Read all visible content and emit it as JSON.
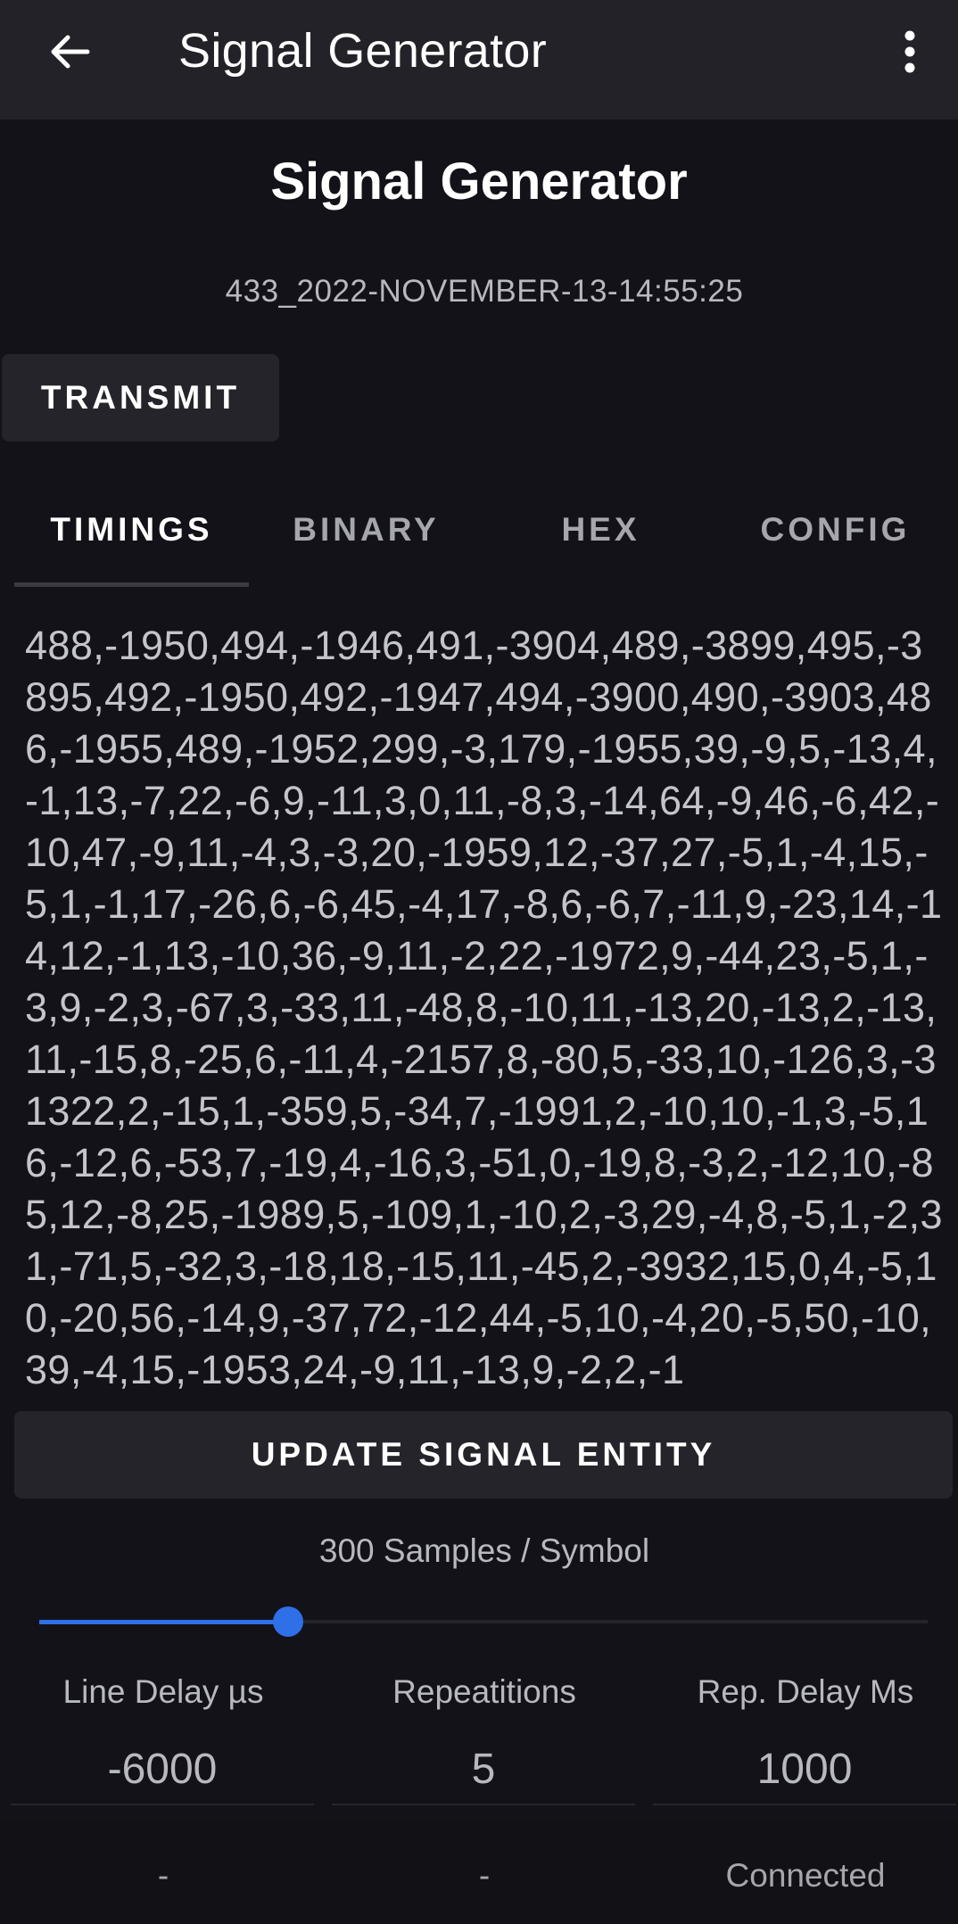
{
  "appbar": {
    "title": "Signal Generator",
    "back_icon": "arrow-left-icon",
    "more_icon": "more-vertical-icon"
  },
  "page": {
    "title": "Signal Generator",
    "signal_name": "433_2022-NOVEMBER-13-14:55:25"
  },
  "buttons": {
    "transmit": "TRANSMIT",
    "update": "UPDATE SIGNAL ENTITY"
  },
  "tabs": [
    {
      "label": "TIMINGS",
      "active": true
    },
    {
      "label": "BINARY",
      "active": false
    },
    {
      "label": "HEX",
      "active": false
    },
    {
      "label": "CONFIG",
      "active": false
    }
  ],
  "timings": {
    "value": "488,-1950,494,-1946,491,-3904,489,-3899,495,-3895,492,-1950,492,-1947,494,-3900,490,-3903,486,-1955,489,-1952,299,-3,179,-1955,39,-9,5,-13,4,-1,13,-7,22,-6,9,-11,3,0,11,-8,3,-14,64,-9,46,-6,42,-10,47,-9,11,-4,3,-3,20,-1959,12,-37,27,-5,1,-4,15,-5,1,-1,17,-26,6,-6,45,-4,17,-8,6,-6,7,-11,9,-23,14,-14,12,-1,13,-10,36,-9,11,-2,22,-1972,9,-44,23,-5,1,-3,9,-2,3,-67,3,-33,11,-48,8,-10,11,-13,20,-13,2,-13,11,-15,8,-25,6,-11,4,-2157,8,-80,5,-33,10,-126,3,-31322,2,-15,1,-359,5,-34,7,-1991,2,-10,10,-1,3,-5,16,-12,6,-53,7,-19,4,-16,3,-51,0,-19,8,-3,2,-12,10,-85,12,-8,25,-1989,5,-109,1,-10,2,-3,29,-4,8,-5,1,-2,31,-71,5,-32,3,-18,18,-15,11,-45,2,-3932,15,0,4,-5,10,-20,56,-14,9,-37,72,-12,44,-5,10,-4,20,-5,50,-10,39,-4,15,-1953,24,-9,11,-13,9,-2,2,-1"
  },
  "samples": {
    "label": "300 Samples / Symbol",
    "slider_fraction": 0.28
  },
  "params": [
    {
      "label": "Line Delay µs",
      "value": "-6000"
    },
    {
      "label": "Repeatitions",
      "value": "5"
    },
    {
      "label": "Rep. Delay Ms",
      "value": "1000"
    }
  ],
  "status": [
    "-",
    "-",
    "Connected"
  ],
  "colors": {
    "accent": "#2f6fe8",
    "background": "#121218",
    "surface": "#24242a"
  }
}
